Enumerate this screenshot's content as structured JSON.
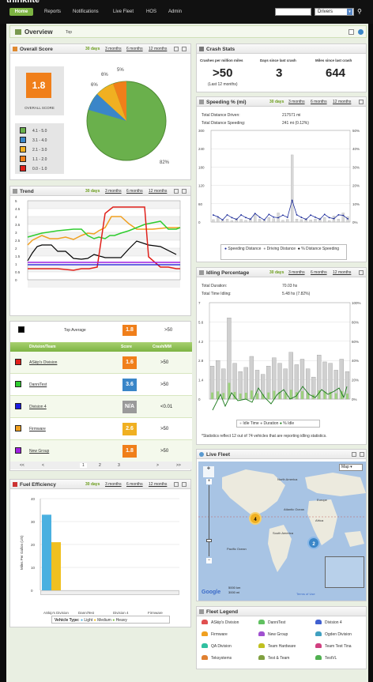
{
  "brand": {
    "logo": "thinklite"
  },
  "nav": {
    "items": [
      "Home",
      "Reports",
      "Notifications",
      "Live Fleet",
      "HOS",
      "Admin"
    ],
    "search_value": "",
    "select_value": "Drivers"
  },
  "overview": {
    "title": "Overview",
    "subtitle": "Top"
  },
  "overall_score": {
    "title": "Overall Score",
    "range": [
      "30 days",
      "3 months",
      "6 months",
      "12 months"
    ],
    "score": "1.8",
    "score_label": "OVERALL SCORE",
    "legend": [
      {
        "label": "4.1 - 5.0",
        "color": "#6ab04c"
      },
      {
        "label": "3.1 - 4.0",
        "color": "#3a86c8"
      },
      {
        "label": "2.1 - 3.0",
        "color": "#f0b021"
      },
      {
        "label": "1.1 - 2.0",
        "color": "#f07f1a"
      },
      {
        "label": "0.0 - 1.0",
        "color": "#e0201a"
      }
    ],
    "pie_labels": [
      "6%",
      "6%",
      "5%",
      "82%"
    ]
  },
  "crash": {
    "title": "Crash Stats",
    "cols": [
      "Crashes per million miles",
      "Days since last crash",
      "Miles since last crash"
    ],
    "values": [
      ">50",
      "3",
      "644"
    ],
    "note": "(Last 12 months)"
  },
  "speeding": {
    "title": "Speeding % (mi)",
    "range": [
      "30 days",
      "3 months",
      "6 months",
      "12 months"
    ],
    "total_label": "Total Distance Driven:",
    "total_value": "217571 mi",
    "speed_label": "Total Distance Speeding:",
    "speed_value": "241 mi (0.12%)",
    "legend": [
      "Speeding Distance",
      "Driving Distance",
      "% Distance Speeding"
    ],
    "yleft": [
      "300",
      "240",
      "180",
      "120",
      "60",
      "0"
    ],
    "yright": [
      "50%",
      "40%",
      "30%",
      "20%",
      "10%",
      "0%"
    ]
  },
  "trend": {
    "title": "Trend",
    "range": [
      "30 days",
      "3 months",
      "6 months",
      "12 months"
    ],
    "yticks": [
      "5",
      "4.5",
      "4",
      "3.5",
      "3",
      "2.5",
      "2",
      "1.5",
      "1",
      "0.5",
      "0"
    ]
  },
  "idling": {
    "title": "Idling Percentage",
    "range": [
      "30 days",
      "3 months",
      "6 months",
      "12 months"
    ],
    "dur_label": "Total Duration:",
    "dur_value": "70.03 hs",
    "idle_label": "Total Time Idling:",
    "idle_value": "5.48 hs (7.82%)",
    "legend": [
      "Idle Time",
      "Duration",
      "% Idle"
    ],
    "yleft": [
      "7",
      "5.6",
      "4.2",
      "2.8",
      "1.4",
      "0"
    ],
    "yright": [
      "100%",
      "80%",
      "60%",
      "40%",
      "20%",
      "0%"
    ],
    "note": "*Statistics reflect 12 out of 74 vehicles that are reporting idling statistics."
  },
  "division": {
    "top_label": "Top Average",
    "top_score": "1.8",
    "top_crash": ">50",
    "headers": [
      "Division/Team",
      "Score",
      "Crash/MM"
    ],
    "rows": [
      {
        "name": "ASkip's Division",
        "score": "1.6",
        "crash": ">50",
        "color": "#e0201a",
        "box": "#f07f1a"
      },
      {
        "name": "DanniTest",
        "score": "3.6",
        "crash": ">50",
        "color": "#2ecc2e",
        "box": "#3a86c8"
      },
      {
        "name": "Division 4",
        "score": "N/A",
        "crash": "<0.01",
        "color": "#1a1ae0",
        "box": "#9a9a9a"
      },
      {
        "name": "Firmware",
        "score": "2.6",
        "crash": ">50",
        "color": "#f0a020",
        "box": "#f0b021"
      },
      {
        "name": "New Group",
        "score": "1.8",
        "crash": ">50",
        "color": "#a020e0",
        "box": "#f07f1a"
      }
    ],
    "pager": [
      "<<",
      "<",
      "1",
      "2",
      "3",
      ">",
      ">>"
    ]
  },
  "live": {
    "title": "Live Fleet",
    "map_btn": "Map",
    "labels": [
      "North America",
      "Atlantic Ocean",
      "Europe",
      "Africa",
      "South America",
      "Pacific Ocean"
    ],
    "markers": [
      "4",
      "2"
    ],
    "scale": [
      "5000 km",
      "3000 mi"
    ],
    "google": "Google",
    "terms": "Terms of Use"
  },
  "fuel": {
    "title": "Fuel Efficiency",
    "range": [
      "30 days",
      "3 months",
      "6 months",
      "12 months"
    ],
    "ylabel": "Miles Per Gallon (US)",
    "yticks": [
      "40",
      "30",
      "20",
      "10",
      "0"
    ],
    "xcats": [
      "ASkip's Division",
      "DanniTest",
      "Division 4",
      "Firmware"
    ],
    "vt_label": "Vehicle Type:",
    "vt": [
      "Light",
      "Medium",
      "Heavy"
    ]
  },
  "chart_data": [
    {
      "type": "bar",
      "title": "Speeding % (mi)",
      "ylim": [
        0,
        300
      ],
      "values": [
        8,
        14,
        6,
        10,
        5,
        12,
        9,
        6,
        13,
        25,
        10,
        6,
        15,
        11,
        30,
        6,
        9,
        220,
        10,
        8,
        12,
        7,
        10,
        13,
        15,
        5,
        20,
        10,
        30,
        18
      ]
    },
    {
      "type": "bar",
      "title": "Idling Percentage",
      "ylim": [
        0,
        7
      ],
      "values": [
        2.4,
        2.8,
        2.2,
        5.9,
        2.6,
        2.0,
        2.3,
        3.1,
        2.1,
        1.8,
        2.4,
        3.0,
        2.6,
        2.2,
        3.4,
        2.5,
        2.9,
        2.2,
        1.6,
        3.2,
        2.7,
        2.6,
        2.1,
        2.9,
        2.0
      ]
    },
    {
      "type": "bar",
      "title": "Fuel Efficiency",
      "ylim": [
        0,
        40
      ],
      "categories": [
        "ASkip's Division",
        "DanniTest",
        "Division 4",
        "Firmware"
      ],
      "values": [
        33,
        21,
        0,
        0
      ]
    }
  ],
  "legend": {
    "title": "Fleet Legend",
    "items": [
      {
        "n": "ASkip's Division",
        "c": "#e05050"
      },
      {
        "n": "DanniTest",
        "c": "#60c060"
      },
      {
        "n": "Division 4",
        "c": "#4060d0"
      },
      {
        "n": "Firmware",
        "c": "#f0a020"
      },
      {
        "n": "New Group",
        "c": "#a050d0"
      },
      {
        "n": "Ogden Division",
        "c": "#40a0c0"
      },
      {
        "n": "QA Division",
        "c": "#30c0a0"
      },
      {
        "n": "Team Hardware",
        "c": "#c0c020"
      },
      {
        "n": "Team Test Tina",
        "c": "#d04080"
      },
      {
        "n": "Teksystems",
        "c": "#e08030"
      },
      {
        "n": "Test & Team",
        "c": "#80a040"
      },
      {
        "n": "TestVL",
        "c": "#50b050"
      }
    ]
  }
}
